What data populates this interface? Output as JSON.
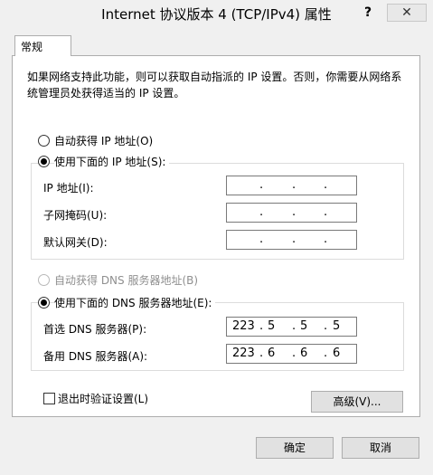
{
  "window": {
    "title": "Internet 协议版本 4 (TCP/IPv4) 属性",
    "help_label": "?",
    "close_label": "✕"
  },
  "tabs": [
    {
      "label": "常规",
      "selected": true
    }
  ],
  "description": "如果网络支持此功能，则可以获取自动指派的 IP 设置。否则，你需要从网络系统管理员处获得适当的 IP 设置。",
  "ip_section": {
    "auto_label": "自动获得 IP 地址(O)",
    "manual_label": "使用下面的 IP 地址(S):",
    "selected": "manual",
    "fields": [
      {
        "label": "IP 地址(I):",
        "octets": [
          "",
          "",
          "",
          ""
        ]
      },
      {
        "label": "子网掩码(U):",
        "octets": [
          "",
          "",
          "",
          ""
        ]
      },
      {
        "label": "默认网关(D):",
        "octets": [
          "",
          "",
          "",
          ""
        ]
      }
    ]
  },
  "dns_section": {
    "auto_label": "自动获得 DNS 服务器地址(B)",
    "auto_disabled": true,
    "manual_label": "使用下面的 DNS 服务器地址(E):",
    "selected": "manual",
    "fields": [
      {
        "label": "首选 DNS 服务器(P):",
        "octets": [
          "223",
          "5",
          "5",
          "5"
        ]
      },
      {
        "label": "备用 DNS 服务器(A):",
        "octets": [
          "223",
          "6",
          "6",
          "6"
        ]
      }
    ]
  },
  "validate_on_exit": {
    "label": "退出时验证设置(L)",
    "checked": false
  },
  "buttons": {
    "advanced": "高级(V)...",
    "ok": "确定",
    "cancel": "取消"
  }
}
